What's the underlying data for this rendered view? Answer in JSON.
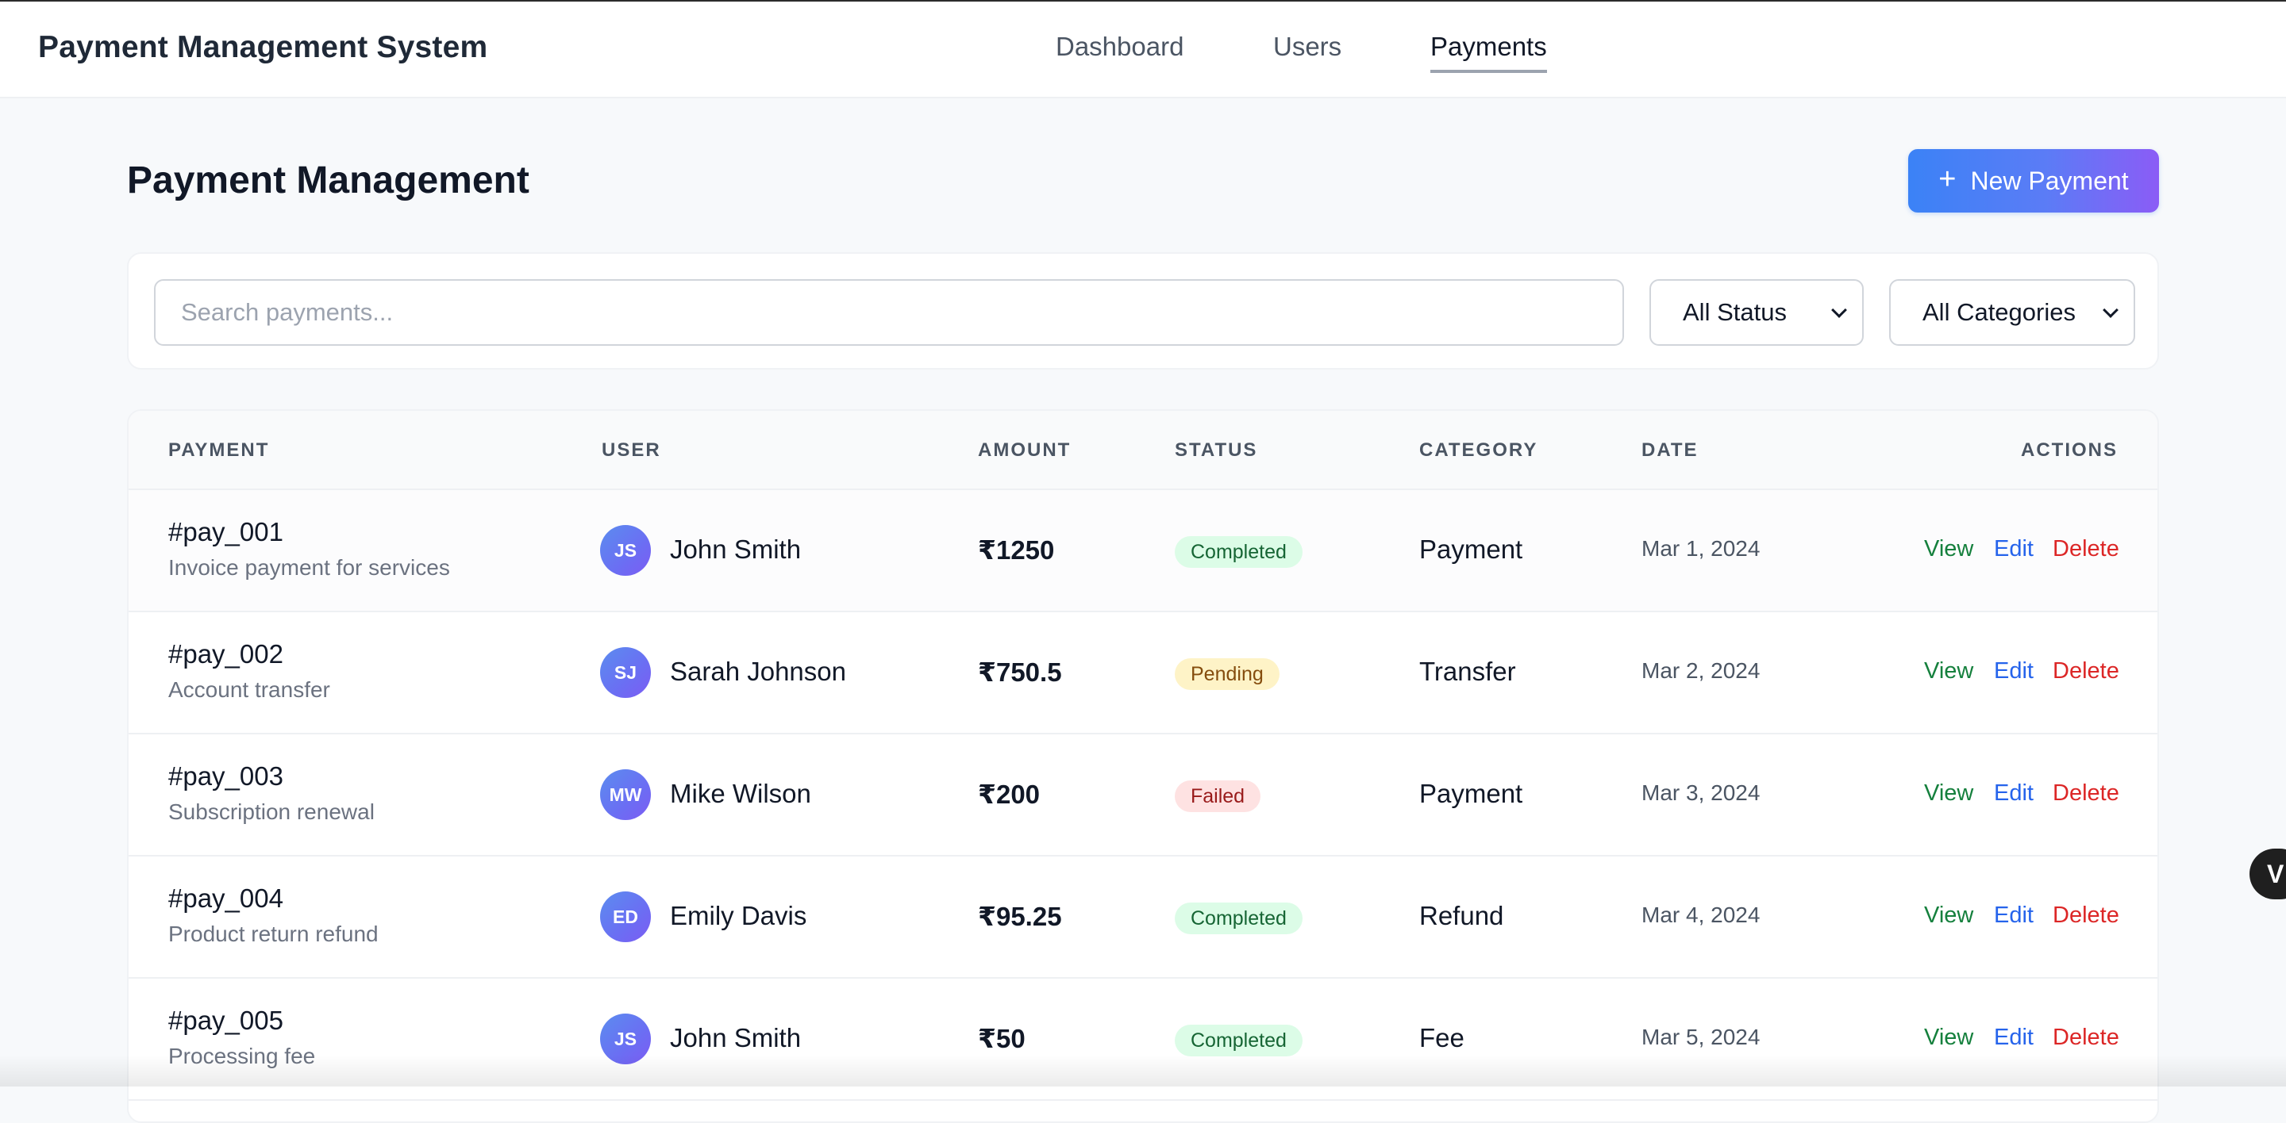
{
  "app": {
    "title": "Payment Management System"
  },
  "nav": {
    "items": [
      {
        "label": "Dashboard",
        "active": false
      },
      {
        "label": "Users",
        "active": false
      },
      {
        "label": "Payments",
        "active": true
      }
    ]
  },
  "page": {
    "title": "Payment Management",
    "new_button_label": "New Payment",
    "new_button_icon": "plus-icon"
  },
  "filters": {
    "search_placeholder": "Search payments...",
    "search_value": "",
    "status_selected": "All Status",
    "category_selected": "All Categories"
  },
  "table": {
    "headers": {
      "payment": "PAYMENT",
      "user": "USER",
      "amount": "AMOUNT",
      "status": "STATUS",
      "category": "CATEGORY",
      "date": "DATE",
      "actions": "ACTIONS"
    },
    "action_labels": {
      "view": "View",
      "edit": "Edit",
      "delete": "Delete"
    },
    "rows": [
      {
        "id": "#pay_001",
        "description": "Invoice payment for services",
        "initials": "JS",
        "user": "John Smith",
        "amount": "₹1250",
        "status": "Completed",
        "status_type": "completed",
        "category": "Payment",
        "date": "Mar 1, 2024"
      },
      {
        "id": "#pay_002",
        "description": "Account transfer",
        "initials": "SJ",
        "user": "Sarah Johnson",
        "amount": "₹750.5",
        "status": "Pending",
        "status_type": "pending",
        "category": "Transfer",
        "date": "Mar 2, 2024"
      },
      {
        "id": "#pay_003",
        "description": "Subscription renewal",
        "initials": "MW",
        "user": "Mike Wilson",
        "amount": "₹200",
        "status": "Failed",
        "status_type": "failed",
        "category": "Payment",
        "date": "Mar 3, 2024"
      },
      {
        "id": "#pay_004",
        "description": "Product return refund",
        "initials": "ED",
        "user": "Emily Davis",
        "amount": "₹95.25",
        "status": "Completed",
        "status_type": "completed",
        "category": "Refund",
        "date": "Mar 4, 2024"
      },
      {
        "id": "#pay_005",
        "description": "Processing fee",
        "initials": "JS",
        "user": "John Smith",
        "amount": "₹50",
        "status": "Completed",
        "status_type": "completed",
        "category": "Fee",
        "date": "Mar 5, 2024"
      }
    ]
  },
  "floating_button": {
    "label": "V"
  },
  "colors": {
    "accent_start": "#3b82f6",
    "accent_end": "#8b5cf6",
    "completed": "#166534",
    "pending": "#854d0e",
    "failed": "#991b1b",
    "view": "#15803d",
    "edit": "#2563eb",
    "delete": "#dc2626"
  }
}
